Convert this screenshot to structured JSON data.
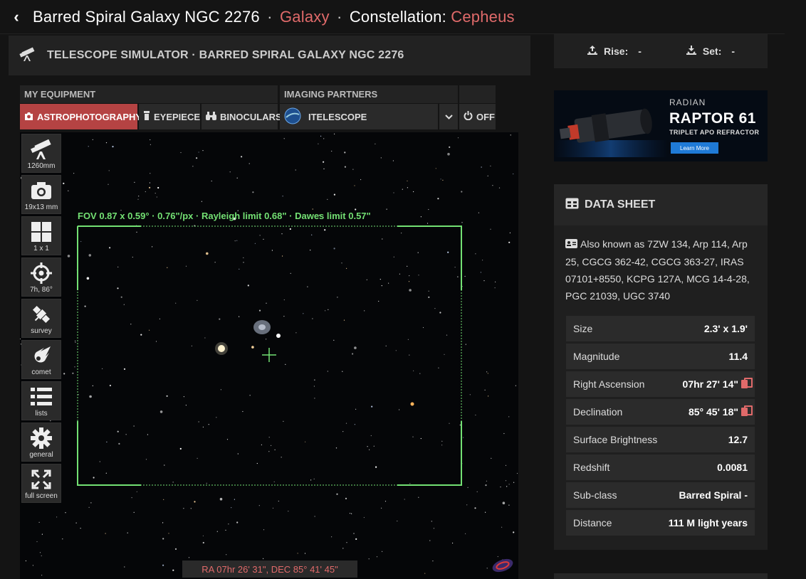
{
  "header": {
    "title": "Barred Spiral Galaxy NGC 2276",
    "dot1": "·",
    "type": "Galaxy",
    "dot2": "·",
    "constellation_label": "Constellation:",
    "constellation": "Cepheus"
  },
  "panel": {
    "title": "TELESCOPE SIMULATOR · BARRED SPIRAL GALAXY NGC 2276"
  },
  "equipment": {
    "my_equipment_label": "MY EQUIPMENT",
    "imaging_partners_label": "IMAGING PARTNERS",
    "buttons": {
      "astro": "ASTROPHOTOGRAPHY",
      "eyepiece": "EYEPIECE",
      "binoculars": "BINOCULARS",
      "partner": "ITELESCOPE",
      "off": "OFF"
    }
  },
  "tools": [
    {
      "label": "1260mm",
      "icon": "telescope-icon"
    },
    {
      "label": "19x13 mm",
      "icon": "camera-icon"
    },
    {
      "label": "1 x 1",
      "icon": "grid-icon"
    },
    {
      "label": "7h, 86°",
      "icon": "crosshair-icon"
    },
    {
      "label": "survey",
      "icon": "satellite-icon"
    },
    {
      "label": "comet",
      "icon": "comet-icon"
    },
    {
      "label": "lists",
      "icon": "list-icon"
    },
    {
      "label": "general",
      "icon": "gear-icon"
    },
    {
      "label": "full screen",
      "icon": "expand-icon"
    }
  ],
  "fov": "FOV 0.87 x 0.59° · 0.76\"/px · Rayleigh limit 0.68\"  · Dawes limit 0.57\"",
  "coords": "RA 07hr 26' 31\", DEC 85° 41' 45\"",
  "rise_set": {
    "rise_label": "Rise:",
    "rise_value": "-",
    "set_label": "Set:",
    "set_value": "-"
  },
  "ad": {
    "brand": "RADIAN",
    "product": "RAPTOR 61",
    "subtitle": "TRIPLET APO REFRACTOR",
    "cta": "Learn More"
  },
  "datasheet": {
    "title": "DATA SHEET",
    "aka": "Also known as 7ZW 134, Arp 114, Arp 25, CGCG 362-42, CGCG 363-27, IRAS 07101+8550, KCPG 127A, MCG 14-4-28, PGC 21039, UGC 3740",
    "rows": [
      {
        "key": "Size",
        "value": "2.3' x 1.9'"
      },
      {
        "key": "Magnitude",
        "value": "11.4"
      },
      {
        "key": "Right Ascension",
        "value": "07hr 27' 14\""
      },
      {
        "key": "Declination",
        "value": "85° 45' 18\""
      },
      {
        "key": "Surface Brightness",
        "value": "12.7"
      },
      {
        "key": "Redshift",
        "value": "0.0081"
      },
      {
        "key": "Sub-class",
        "value": "Barred Spiral -"
      },
      {
        "key": "Distance",
        "value": "111 M light years"
      }
    ]
  },
  "colors": {
    "accent_red": "#b54343",
    "text_red": "#e06a6a",
    "fov_green": "#73e073",
    "ad_button": "#1f7ad6"
  }
}
